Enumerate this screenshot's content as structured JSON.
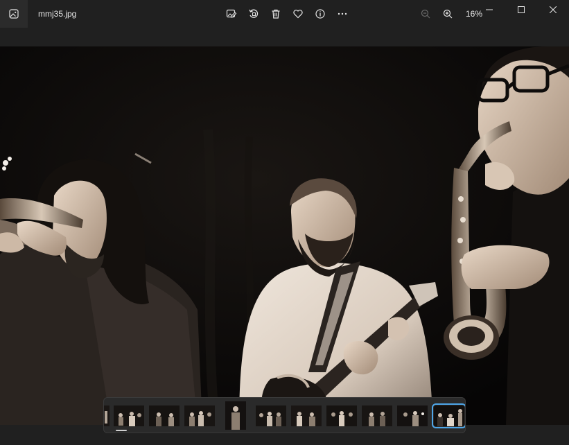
{
  "window": {
    "file_name": "mmj35.jpg",
    "zoom_level": "16%"
  },
  "toolbar": {
    "buttons": [
      "edit-image-icon",
      "rotate-icon",
      "delete-icon",
      "favorite-icon",
      "info-icon",
      "more-icon"
    ]
  },
  "zoom": {
    "buttons": [
      "zoom-out-icon",
      "zoom-in-icon"
    ]
  },
  "window_controls": [
    "minimize-icon",
    "maximize-icon",
    "close-icon"
  ],
  "filmstrip": {
    "thumbnail_count": 11,
    "selected_index": 10
  },
  "colors": {
    "titlebar": "#202020",
    "accent_selection": "#4ea6e8",
    "photo_tone": "#e8dcd0"
  }
}
